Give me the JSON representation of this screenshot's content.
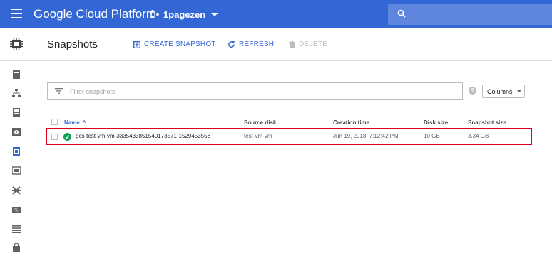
{
  "header": {
    "app_title": "Google Cloud Platform",
    "project_name": "1pagezen",
    "page_title": "Snapshots",
    "create_label": "CREATE SNAPSHOT",
    "refresh_label": "REFRESH",
    "delete_label": "DELETE"
  },
  "colors": {
    "topbar": "#3367d6",
    "accent": "#3367d6",
    "status_ok": "#0f9d58",
    "highlight": "#d7001d"
  },
  "nav": {
    "icons": [
      "product-chip-icon",
      "instance-groups-icon",
      "network-icon",
      "instance-templates-icon",
      "disks-icon",
      "snapshots-icon",
      "images-icon",
      "tpus-icon",
      "committed-use-icon",
      "metadata-icon",
      "zones-icon",
      "security-icon"
    ]
  },
  "filter": {
    "placeholder": "Filter snapshots",
    "columns_label": "Columns"
  },
  "table": {
    "headers": {
      "name": "Name",
      "source_disk": "Source disk",
      "creation_time": "Creation time",
      "disk_size": "Disk size",
      "snapshot_size": "Snapshot size"
    },
    "sort": "Name ascending",
    "rows": [
      {
        "status": "ok",
        "name": "gcs-test-vm-vm-3335433851540173571-1529453558",
        "source_disk": "test-vm-vm",
        "creation_time": "Jun 19, 2018, 7:12:42 PM",
        "disk_size": "10 GB",
        "snapshot_size": "3.34 GB"
      }
    ]
  }
}
